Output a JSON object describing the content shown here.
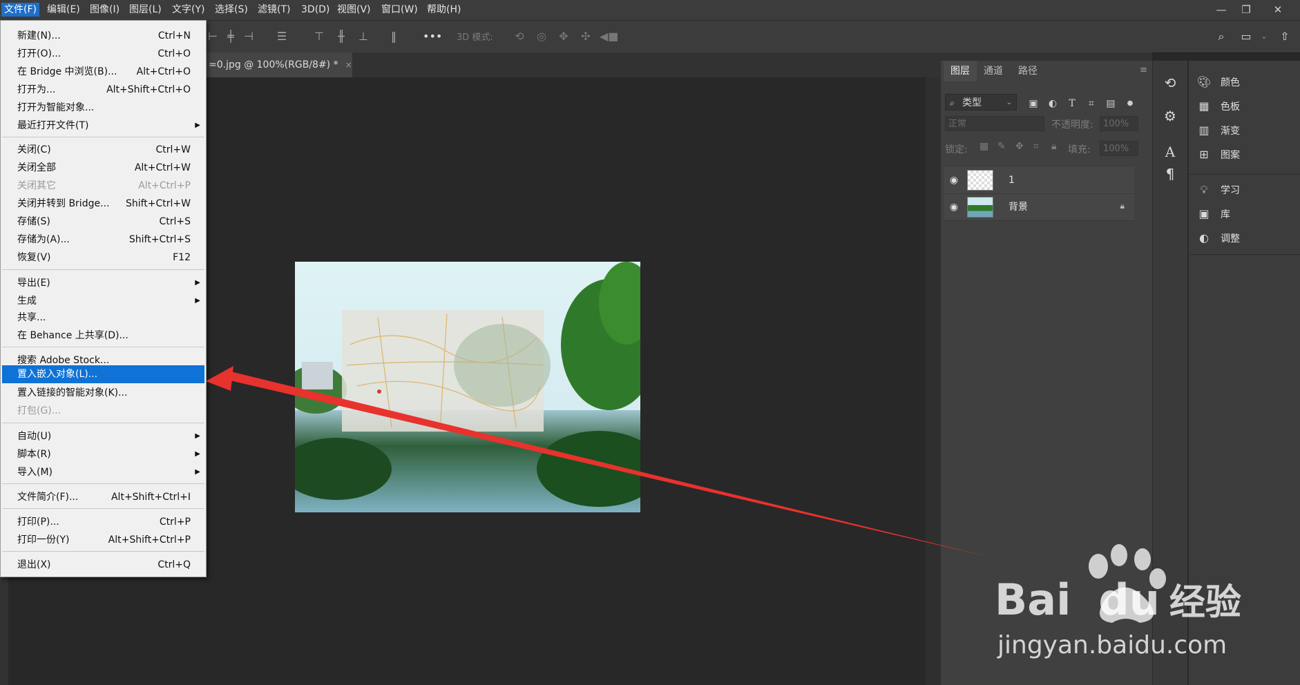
{
  "menubar": {
    "items": [
      "文件(F)",
      "编辑(E)",
      "图像(I)",
      "图层(L)",
      "文字(Y)",
      "选择(S)",
      "滤镜(T)",
      "3D(D)",
      "视图(V)",
      "窗口(W)",
      "帮助(H)"
    ]
  },
  "window_controls": {
    "minimize": "—",
    "restore": "❐",
    "close": "✕"
  },
  "options_bar": {
    "mode3d_label": "3D 模式:"
  },
  "document_tab": {
    "title": "=0.jpg @ 100%(RGB/8#) *",
    "close": "×"
  },
  "file_menu": {
    "items": [
      {
        "label": "新建(N)...",
        "shortcut": "Ctrl+N"
      },
      {
        "label": "打开(O)...",
        "shortcut": "Ctrl+O"
      },
      {
        "label": "在 Bridge 中浏览(B)...",
        "shortcut": "Alt+Ctrl+O"
      },
      {
        "label": "打开为...",
        "shortcut": "Alt+Shift+Ctrl+O"
      },
      {
        "label": "打开为智能对象...",
        "shortcut": ""
      },
      {
        "label": "最近打开文件(T)",
        "shortcut": ""
      },
      {
        "label": "关闭(C)",
        "shortcut": "Ctrl+W"
      },
      {
        "label": "关闭全部",
        "shortcut": "Alt+Ctrl+W"
      },
      {
        "label": "关闭其它",
        "shortcut": "Alt+Ctrl+P"
      },
      {
        "label": "关闭并转到 Bridge...",
        "shortcut": "Shift+Ctrl+W"
      },
      {
        "label": "存储(S)",
        "shortcut": "Ctrl+S"
      },
      {
        "label": "存储为(A)...",
        "shortcut": "Shift+Ctrl+S"
      },
      {
        "label": "恢复(V)",
        "shortcut": "F12"
      },
      {
        "label": "导出(E)",
        "shortcut": ""
      },
      {
        "label": "生成",
        "shortcut": ""
      },
      {
        "label": "共享...",
        "shortcut": ""
      },
      {
        "label": "在 Behance 上共享(D)...",
        "shortcut": ""
      },
      {
        "label": "搜索 Adobe Stock...",
        "shortcut": ""
      },
      {
        "label": "置入嵌入对象(L)...",
        "shortcut": ""
      },
      {
        "label": "置入链接的智能对象(K)...",
        "shortcut": ""
      },
      {
        "label": "打包(G)...",
        "shortcut": ""
      },
      {
        "label": "自动(U)",
        "shortcut": ""
      },
      {
        "label": "脚本(R)",
        "shortcut": ""
      },
      {
        "label": "导入(M)",
        "shortcut": ""
      },
      {
        "label": "文件简介(F)...",
        "shortcut": "Alt+Shift+Ctrl+I"
      },
      {
        "label": "打印(P)...",
        "shortcut": "Ctrl+P"
      },
      {
        "label": "打印一份(Y)",
        "shortcut": "Alt+Shift+Ctrl+P"
      },
      {
        "label": "退出(X)",
        "shortcut": "Ctrl+Q"
      }
    ],
    "highlighted": "置入嵌入对象(L)..."
  },
  "layers_panel": {
    "tabs": [
      "图层",
      "通道",
      "路径"
    ],
    "filter_label": "类型",
    "blend_mode": "正常",
    "opacity_label": "不透明度:",
    "opacity_value": "100%",
    "lock_label": "锁定:",
    "fill_label": "填充:",
    "fill_value": "100%",
    "layers": [
      {
        "name": "1"
      },
      {
        "name": "背景"
      }
    ]
  },
  "right_panels": {
    "items": [
      "颜色",
      "色板",
      "渐变",
      "图案",
      "学习",
      "库",
      "调整"
    ]
  },
  "watermark": {
    "brand_a": "Bai",
    "brand_b": "du",
    "brand_c": "经验",
    "url": "jingyan.baidu.com"
  },
  "colors": {
    "highlight": "#0e72d6",
    "arrow": "#e8322d",
    "panel": "#404040"
  }
}
